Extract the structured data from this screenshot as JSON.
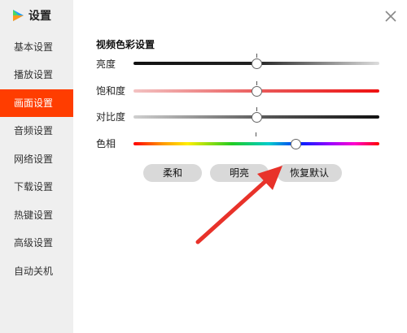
{
  "window": {
    "title": "设置",
    "close_icon": "close-icon"
  },
  "sidebar": {
    "items": [
      {
        "label": "基本设置",
        "active": false
      },
      {
        "label": "播放设置",
        "active": false
      },
      {
        "label": "画面设置",
        "active": true
      },
      {
        "label": "音频设置",
        "active": false
      },
      {
        "label": "网络设置",
        "active": false
      },
      {
        "label": "下载设置",
        "active": false
      },
      {
        "label": "热键设置",
        "active": false
      },
      {
        "label": "高级设置",
        "active": false
      },
      {
        "label": "自动关机",
        "active": false
      }
    ]
  },
  "video_color": {
    "title": "视频色彩设置",
    "sliders": [
      {
        "label": "亮度",
        "value": 0.5
      },
      {
        "label": "饱和度",
        "value": 0.5
      },
      {
        "label": "对比度",
        "value": 0.5
      },
      {
        "label": "色相",
        "value": 0.66
      }
    ],
    "presets": [
      "柔和",
      "明亮",
      "恢复默认"
    ]
  },
  "colors": {
    "accent": "#ff3d00",
    "annotation_arrow": "#e8322a"
  }
}
